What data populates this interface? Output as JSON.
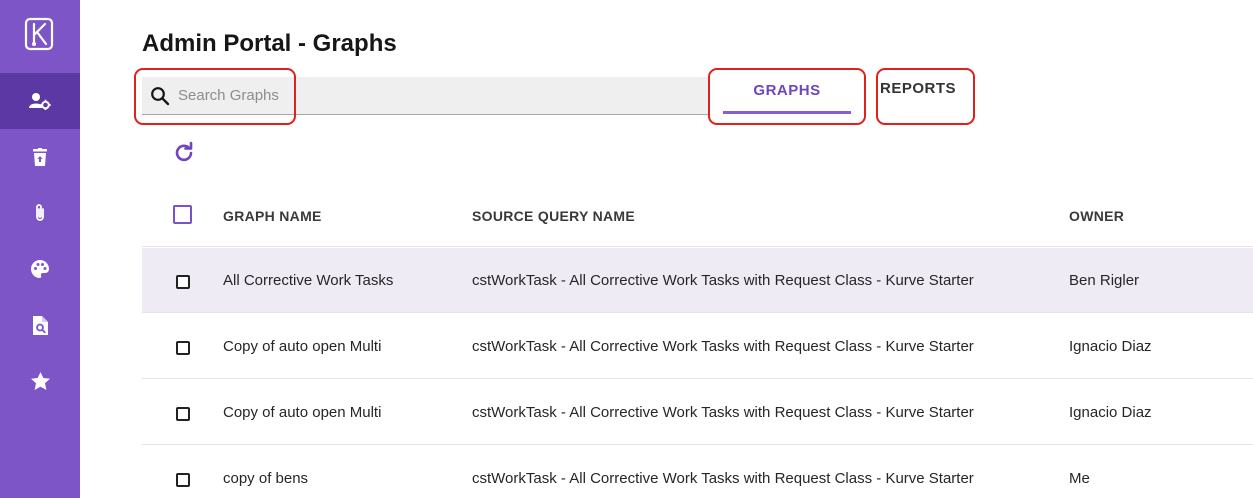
{
  "page": {
    "title": "Admin Portal - Graphs"
  },
  "search": {
    "placeholder": "Search Graphs",
    "value": ""
  },
  "tabs": [
    {
      "label": "GRAPHS",
      "active": true
    },
    {
      "label": "REPORTS",
      "active": false
    }
  ],
  "sidebar": {
    "items": [
      {
        "icon": "logo-icon"
      },
      {
        "icon": "admin-users-icon",
        "active": true
      },
      {
        "icon": "trash-restore-icon"
      },
      {
        "icon": "paperclip-icon"
      },
      {
        "icon": "palette-icon"
      },
      {
        "icon": "file-search-icon"
      },
      {
        "icon": "star-icon"
      }
    ]
  },
  "table": {
    "columns": {
      "name": "GRAPH NAME",
      "query": "SOURCE QUERY NAME",
      "owner": "OWNER"
    },
    "rows": [
      {
        "name": "All Corrective Work Tasks",
        "query": "cstWorkTask - All Corrective Work Tasks with Request Class - Kurve Starter",
        "owner": "Ben Rigler",
        "selected": true
      },
      {
        "name": "Copy of auto open Multi",
        "query": "cstWorkTask - All Corrective Work Tasks with Request Class - Kurve Starter",
        "owner": "Ignacio Diaz",
        "selected": false
      },
      {
        "name": "Copy of auto open Multi",
        "query": "cstWorkTask - All Corrective Work Tasks with Request Class - Kurve Starter",
        "owner": "Ignacio Diaz",
        "selected": false
      },
      {
        "name": "copy of bens",
        "query": "cstWorkTask - All Corrective Work Tasks with Request Class - Kurve Starter",
        "owner": "Me",
        "selected": false
      }
    ]
  },
  "colors": {
    "sidebar": "#7d55c7",
    "sidebar_active": "#5b38a3",
    "accent": "#6f45c0",
    "highlight_box": "#e0201c",
    "selected_row": "#efebf5"
  }
}
